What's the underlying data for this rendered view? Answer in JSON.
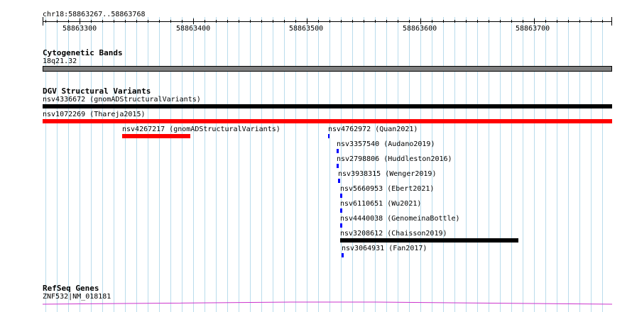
{
  "ruler": {
    "location": "chr18:58863267..58863768",
    "ticks": [
      "58863300",
      "58863400",
      "58863500",
      "58863600",
      "58863700"
    ]
  },
  "cytoband": {
    "title": "Cytogenetic Bands",
    "band_label": "18q21.32",
    "band_color": "#7f7f7f"
  },
  "dgv": {
    "title": "DGV Structural Variants",
    "features": [
      {
        "label": "nsv4336672 (gnomADStructuralVariants)",
        "color": "#000000"
      },
      {
        "label": "nsv1072269 (Thareja2015)",
        "color": "#ff0000"
      },
      {
        "label": "nsv4267217 (gnomADStructuralVariants)",
        "color": "#ff0000"
      },
      {
        "label": "nsv4762972 (Quan2021)",
        "color": "#0000ff"
      },
      {
        "label": "nsv3357540 (Audano2019)",
        "color": "#0000ff"
      },
      {
        "label": "nsv2798806 (Huddleston2016)",
        "color": "#0000ff"
      },
      {
        "label": "nsv3938315 (Wenger2019)",
        "color": "#0000ff"
      },
      {
        "label": "nsv5660953 (Ebert2021)",
        "color": "#0000ff"
      },
      {
        "label": "nsv6110651 (Wu2021)",
        "color": "#0000ff"
      },
      {
        "label": "nsv4440038 (GenomeinaBottle)",
        "color": "#0000ff"
      },
      {
        "label": "nsv3208612 (Chaisson2019)",
        "color": "#000000"
      },
      {
        "label": "nsv3064931 (Fan2017)",
        "color": "#0000ff"
      }
    ]
  },
  "refseq": {
    "title": "RefSeq Genes",
    "gene_label": "ZNF532|NM_018181",
    "gene_color": "#cc33cc"
  }
}
